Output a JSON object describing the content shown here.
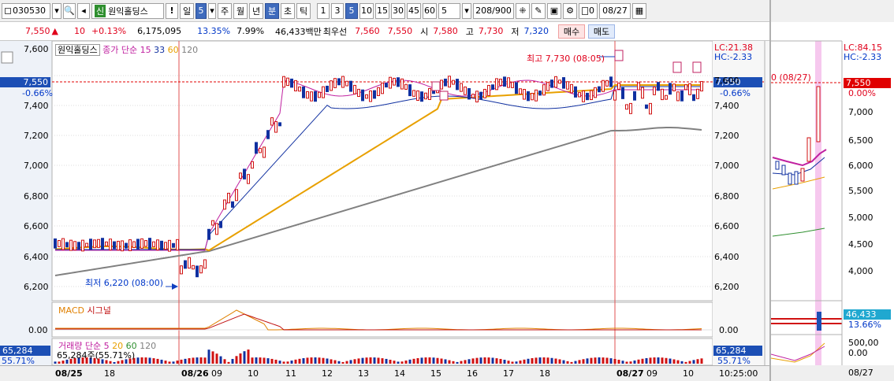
{
  "toolbar": {
    "code": "030530",
    "name": "원익홀딩스",
    "badge": "신",
    "period_sel": "일",
    "period_num": "5",
    "periods": [
      "주",
      "월",
      "년",
      "분",
      "초",
      "틱"
    ],
    "minutes": [
      "1",
      "3",
      "5",
      "10",
      "15",
      "30",
      "45",
      "60"
    ],
    "minute_sel": "5",
    "count_input": "5",
    "count_display": "208/900",
    "date": "08/27",
    "checkbox_label": "0"
  },
  "quote": {
    "price": "7,550",
    "change": "10",
    "pct": "+0.13%",
    "volume": "6,175,095",
    "ratio": "13.35%",
    "pct2": "7.99%",
    "amount": "46,433백만",
    "best_label": "최우선",
    "bid": "7,560",
    "ask": "7,550",
    "open_label": "시",
    "open": "7,580",
    "high_label": "고",
    "high": "7,730",
    "low_label": "저",
    "low": "7,320",
    "buy_label": "매수",
    "sell_label": "매도"
  },
  "chart": {
    "legend_name": "원익홀딩스",
    "legend_text": "종가 단순",
    "ma": [
      "15",
      "33",
      "60",
      "120"
    ],
    "lc": "LC:21.38",
    "hc": "HC:-2.33",
    "price_tag": "7,550",
    "pct_tag": "-0.66%",
    "high_ann": "최고 7,730 (08:05)",
    "low_ann": "최저 6,220 (08:00)",
    "y_ticks": [
      "7,600",
      "7,400",
      "7,200",
      "7,000",
      "6,800",
      "6,600",
      "6,400",
      "6,200"
    ],
    "macd_label": "MACD",
    "signal_label": "시그널",
    "macd_zero": "0.00",
    "vol_label": "거래량",
    "vol_legend": "단순",
    "vol_ma": [
      "5",
      "20",
      "60",
      "120"
    ],
    "vol_tag": "65,284",
    "vol_pct": "55.71%",
    "vol_text": "65,284주(55.71%)",
    "x_labels": [
      "08/25",
      "18",
      "08/26",
      "09",
      "10",
      "11",
      "12",
      "13",
      "14",
      "15",
      "16",
      "17",
      "18",
      "08/27",
      "09",
      "10"
    ],
    "time": "10:25:00"
  },
  "daily": {
    "lc": "LC:84.15",
    "hc": "HC:-2.33",
    "price_tag": "7,550",
    "pct_tag": "0.00%",
    "ann": "0 (08/27)",
    "y_ticks": [
      "7,000",
      "6,500",
      "6,000",
      "5,500",
      "5,000",
      "4,500",
      "4,000"
    ],
    "vol_tag": "46,433",
    "vol_pct": "13.66%",
    "vol_ticks": [
      "500,00",
      "0.00"
    ],
    "x_label": "08/27"
  }
}
